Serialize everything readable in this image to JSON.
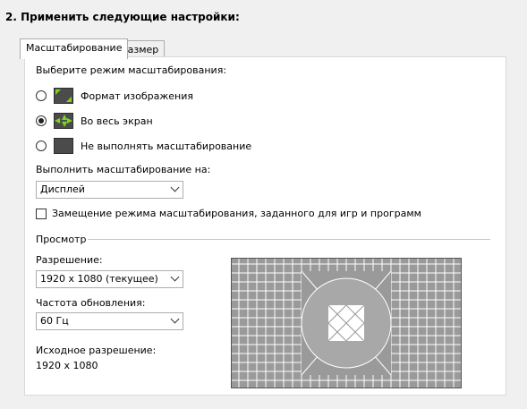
{
  "section_title": "2. Применить следующие настройки:",
  "tabs": [
    {
      "label": "Масштабирование",
      "active": true
    },
    {
      "label": "Размер",
      "active": false
    }
  ],
  "scaling": {
    "prompt": "Выберите режим масштабирования:",
    "options": [
      {
        "label": "Формат изображения",
        "icon": "aspect-ratio-icon",
        "selected": false
      },
      {
        "label": "Во весь экран",
        "icon": "full-screen-icon",
        "selected": true
      },
      {
        "label": "Не выполнять масштабирование",
        "icon": "no-scaling-icon",
        "selected": false
      }
    ],
    "perform_on_label": "Выполнить масштабирование на:",
    "perform_on_value": "Дисплей",
    "override_label": "Замещение режима масштабирования, заданного для игр и программ",
    "override_checked": false
  },
  "preview": {
    "heading": "Просмотр",
    "resolution_label": "Разрешение:",
    "resolution_value": "1920 x 1080 (текущее)",
    "refresh_label": "Частота обновления:",
    "refresh_value": "60 Гц",
    "source_label": "Исходное разрешение:",
    "source_value": "1920 x 1080"
  },
  "colors": {
    "icon_arrow": "#7ed321",
    "preview_bg": "#9a9a9a",
    "preview_grid": "#ffffff"
  }
}
